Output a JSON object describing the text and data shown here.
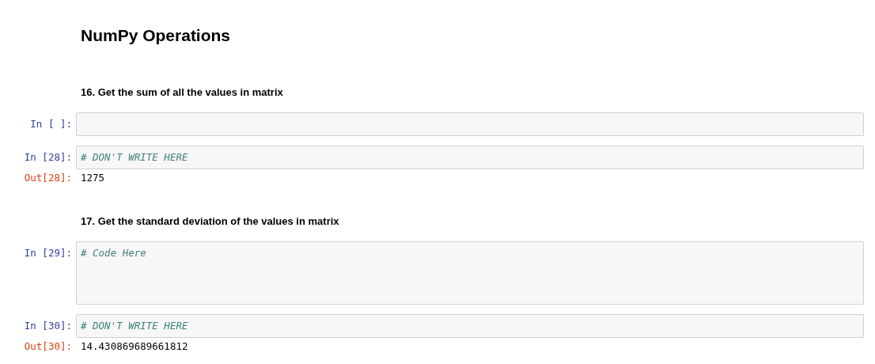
{
  "cells": [
    {
      "kind": "heading",
      "text": "NumPy Operations"
    },
    {
      "kind": "markdown",
      "text": "16. Get the sum of all the values in matrix"
    },
    {
      "kind": "code",
      "prompt": "In [ ]:"
    },
    {
      "kind": "code",
      "prompt": "In [28]:",
      "code": "# DON'T WRITE HERE",
      "out_prompt": "Out[28]:",
      "output": "1275"
    },
    {
      "kind": "markdown",
      "text": "17. Get the standard deviation of the values in matrix"
    },
    {
      "kind": "code",
      "prompt": "In [29]:",
      "code": "# Code Here\n\n\n"
    },
    {
      "kind": "code",
      "prompt": "In [30]:",
      "code": "# DON'T WRITE HERE",
      "out_prompt": "Out[30]:",
      "output": "14.430869689661812"
    }
  ]
}
